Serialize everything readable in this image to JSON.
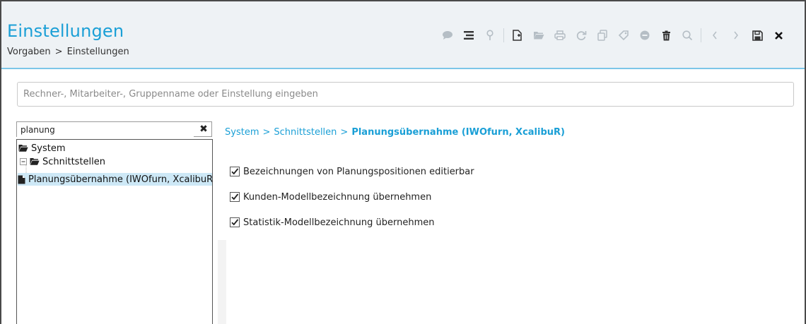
{
  "header": {
    "title": "Einstellungen",
    "breadcrumb": [
      "Vorgaben",
      "Einstellungen"
    ],
    "breadcrumb_sep": ">"
  },
  "toolbar": {
    "icons": [
      "chat-icon",
      "list-icon",
      "pin-icon",
      "new-document-icon",
      "open-folder-icon",
      "print-icon",
      "refresh-icon",
      "copy-icon",
      "tag-icon",
      "minus-circle-icon",
      "trash-icon",
      "search-icon",
      "prev-icon",
      "next-icon",
      "save-icon",
      "close-icon"
    ],
    "accent": "#1a9fd6"
  },
  "search": {
    "placeholder": "Rechner-, Mitarbeiter-, Gruppenname oder Einstellung eingeben",
    "value": ""
  },
  "tree_filter": {
    "value": "planung",
    "clear_icon": "close-icon"
  },
  "tree": {
    "items": [
      {
        "label": "System",
        "level": 0,
        "icon": "folder-open-icon"
      },
      {
        "label": "Schnittstellen",
        "level": 1,
        "icon": "folder-open-icon",
        "expander": "minus"
      },
      {
        "label": "Planungsübernahme (IWOfurn, XcalibuR)",
        "level": 2,
        "icon": "document-icon",
        "selected": true
      }
    ]
  },
  "content": {
    "path": [
      "System",
      "Schnittstellen"
    ],
    "path_sep": ">",
    "current": "Planungsübernahme (IWOfurn, XcalibuR)",
    "options": [
      {
        "label": "Bezeichnungen von Planungspositionen editierbar",
        "checked": true
      },
      {
        "label": "Kunden-Modellbezeichnung übernehmen",
        "checked": true
      },
      {
        "label": "Statistik-Modellbezeichnung übernehmen",
        "checked": true
      }
    ]
  },
  "colors": {
    "header_bg": "#eef2f5",
    "accent": "#1a9fd6",
    "selected_row": "#cde8f6"
  }
}
